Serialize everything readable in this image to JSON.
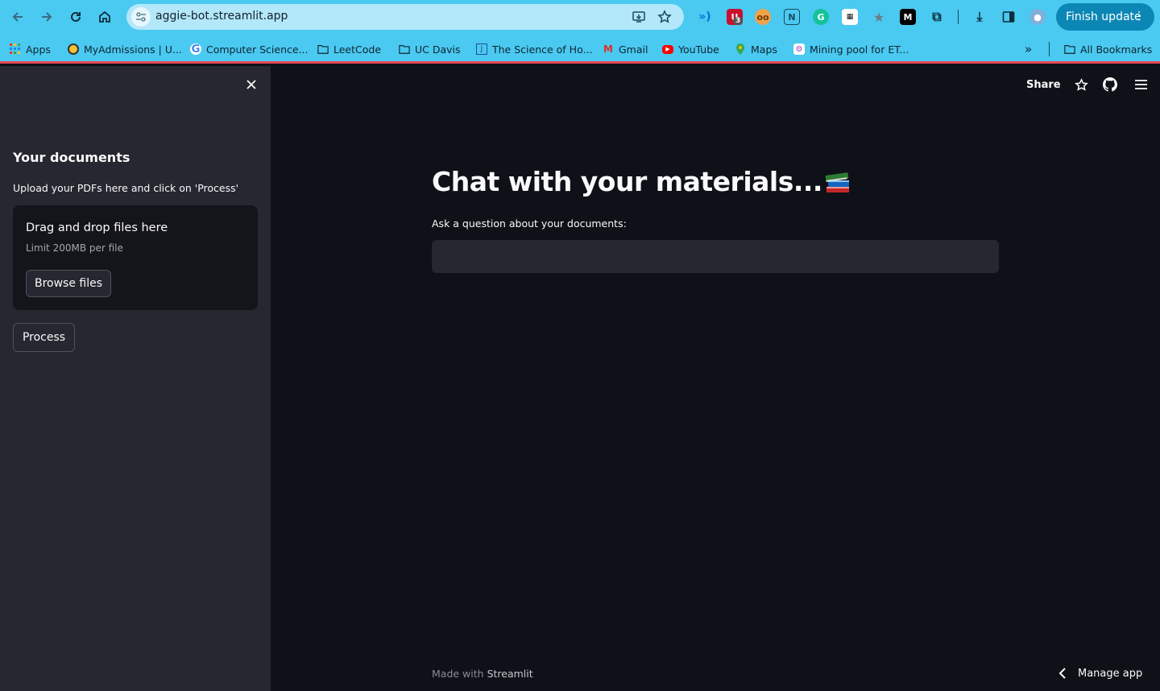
{
  "browser": {
    "url": "aggie-bot.streamlit.app",
    "finish_update": "Finish update",
    "ext_badge": "3",
    "bookmarks": [
      {
        "label": "Apps",
        "icon": "apps-grid-icon"
      },
      {
        "label": "MyAdmissions | U...",
        "icon": "myadmissions-icon"
      },
      {
        "label": "Computer Science...",
        "icon": "google-icon"
      },
      {
        "label": "LeetCode",
        "icon": "folder-icon"
      },
      {
        "label": "UC Davis",
        "icon": "folder-icon"
      },
      {
        "label": "The Science of Ho...",
        "icon": "page-icon"
      },
      {
        "label": "Gmail",
        "icon": "gmail-icon"
      },
      {
        "label": "YouTube",
        "icon": "youtube-icon"
      },
      {
        "label": "Maps",
        "icon": "maps-icon"
      },
      {
        "label": "Mining pool for ET...",
        "icon": "mining-icon"
      }
    ],
    "all_bookmarks": "All Bookmarks"
  },
  "sidebar": {
    "title": "Your documents",
    "subtitle": "Upload your PDFs here and click on 'Process'",
    "dropzone_title": "Drag and drop files here",
    "dropzone_limit": "Limit 200MB per file",
    "browse_label": "Browse files",
    "process_label": "Process"
  },
  "header": {
    "share": "Share"
  },
  "main": {
    "title": "Chat with your materials...",
    "title_emoji": "books-icon",
    "question_label": "Ask a question about your documents:",
    "question_value": ""
  },
  "footer": {
    "made_with": "Made with",
    "brand": "Streamlit",
    "manage_app": "Manage app"
  },
  "colors": {
    "chrome": "#4ac9f1",
    "app_bg": "#0e1117",
    "sidebar_bg": "#262730",
    "accent_line": "#e8475b"
  }
}
